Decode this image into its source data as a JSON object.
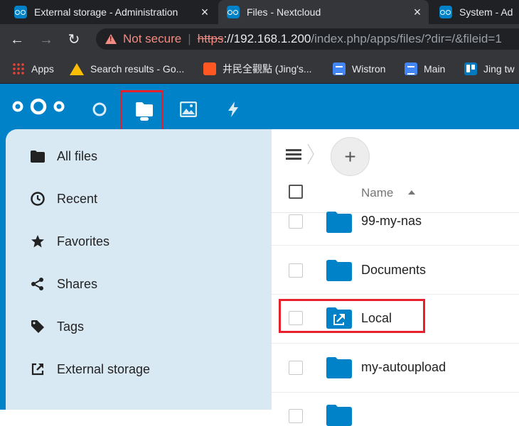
{
  "browser": {
    "tabs": [
      {
        "title": "External storage - Administration",
        "active": false
      },
      {
        "title": "Files - Nextcloud",
        "active": true
      },
      {
        "title": "System - Ad",
        "active": false
      }
    ],
    "omnibox": {
      "security_label": "Not secure",
      "scheme": "https",
      "host": "://192.168.1.200",
      "path": "/index.php/apps/files/?dir=/&fileid=1"
    },
    "bookmarks": [
      {
        "label": "Apps",
        "icon": "apps-grid-icon"
      },
      {
        "label": "Search results - Go...",
        "icon": "drive-icon"
      },
      {
        "label": "井民全觀點 (Jing's...",
        "icon": "blogger-icon"
      },
      {
        "label": "Wistron",
        "icon": "docs-icon"
      },
      {
        "label": "Main",
        "icon": "docs-icon"
      },
      {
        "label": "Jing tw",
        "icon": "trello-icon"
      }
    ]
  },
  "nextcloud": {
    "brand_color": "#0082c9",
    "header_apps": [
      "dashboard-icon",
      "files-icon",
      "photos-icon",
      "activity-icon"
    ],
    "active_app": "files-icon",
    "sidebar": {
      "items": [
        {
          "label": "All files",
          "icon": "folder-icon"
        },
        {
          "label": "Recent",
          "icon": "clock-icon"
        },
        {
          "label": "Favorites",
          "icon": "star-icon"
        },
        {
          "label": "Shares",
          "icon": "share-icon"
        },
        {
          "label": "Tags",
          "icon": "tag-icon"
        },
        {
          "label": "External storage",
          "icon": "external-link-icon"
        }
      ]
    },
    "files": {
      "new_button_label": "+",
      "column_name": "Name",
      "rows": [
        {
          "name": "99-my-nas",
          "type": "folder"
        },
        {
          "name": "Documents",
          "type": "folder"
        },
        {
          "name": "Local",
          "type": "external-folder"
        },
        {
          "name": "my-autoupload",
          "type": "folder"
        }
      ]
    }
  },
  "annotation_color": "#e8202d"
}
